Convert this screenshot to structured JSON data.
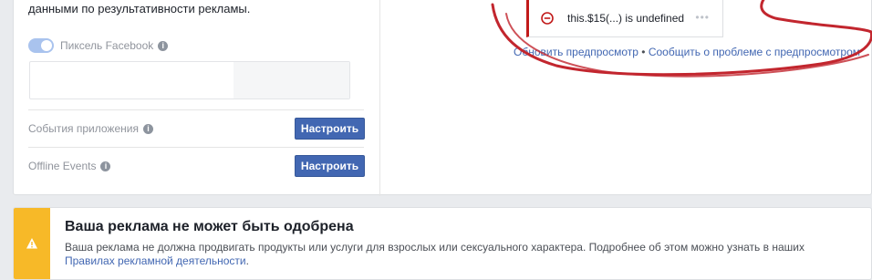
{
  "config": {
    "intro_text": "данными по результативности рекламы.",
    "pixel": {
      "label": "Пиксель Facebook",
      "enabled": true,
      "icon": "info-icon"
    },
    "rows": [
      {
        "label": "События приложения",
        "button": "Настроить"
      },
      {
        "label": "Offline Events",
        "button": "Настроить"
      }
    ]
  },
  "preview": {
    "error_text": "this.$15(...) is undefined",
    "refresh_link": "Обновить предпросмотр",
    "separator": "•",
    "report_link": "Сообщить о проблеме с предпросмотром",
    "error_color": "#c11a1a"
  },
  "warning": {
    "title": "Ваша реклама не может быть одобрена",
    "body": "Ваша реклама не должна продвигать продукты или услуги для взрослых или сексуального характера. Подробнее об этом можно узнать в наших",
    "link": "Правилах рекламной деятельности",
    "after_link": ".",
    "accent_color": "#f7b928"
  },
  "annotation": {
    "color": "#c2262e"
  }
}
